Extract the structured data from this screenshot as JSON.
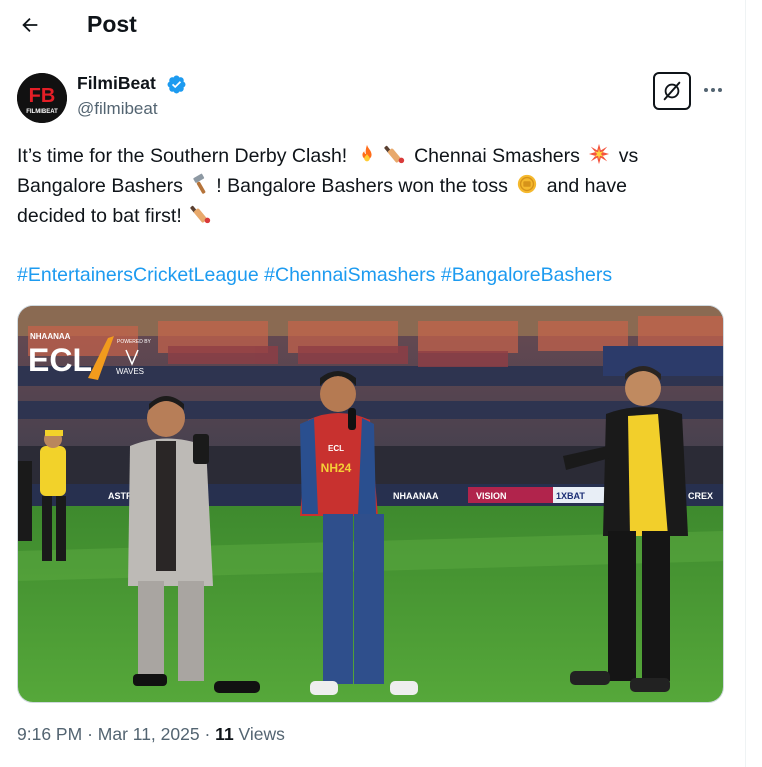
{
  "header": {
    "title": "Post"
  },
  "author": {
    "name": "FilmiBeat",
    "handle": "@filmibeat",
    "avatar_letters": "FB",
    "avatar_sub": "FILMIBEAT"
  },
  "tweet": {
    "line1_a": "It’s time for the Southern Derby Clash!",
    "line1_b": "Chennai Smashers",
    "line1_c": "vs",
    "line2_a": "Bangalore Bashers",
    "line2_b": "! Bangalore Bashers won the toss",
    "line2_c": "and have",
    "line3_a": "decided to bat first!",
    "hashtags": [
      "#EntertainersCricketLeague",
      "#ChennaiSmashers",
      "#BangaloreBashers"
    ]
  },
  "media": {
    "logo_brand": "NHAANAA",
    "logo_main": "ECL",
    "logo_powered": "POWERED BY",
    "logo_sponsor": "WAVES",
    "boards": [
      "1XBAT",
      "VISION",
      "ASTRAL LINE",
      "NHAANAA",
      "CREX"
    ],
    "jersey_text": "NH24",
    "jersey_logo": "ECL"
  },
  "meta": {
    "time": "9:16 PM",
    "separator": "·",
    "date": "Mar 11, 2025",
    "views_count": "11",
    "views_label": "Views"
  },
  "colors": {
    "link": "#1d9bf0",
    "secondary": "#536471",
    "verified": "#1d9bf0"
  }
}
